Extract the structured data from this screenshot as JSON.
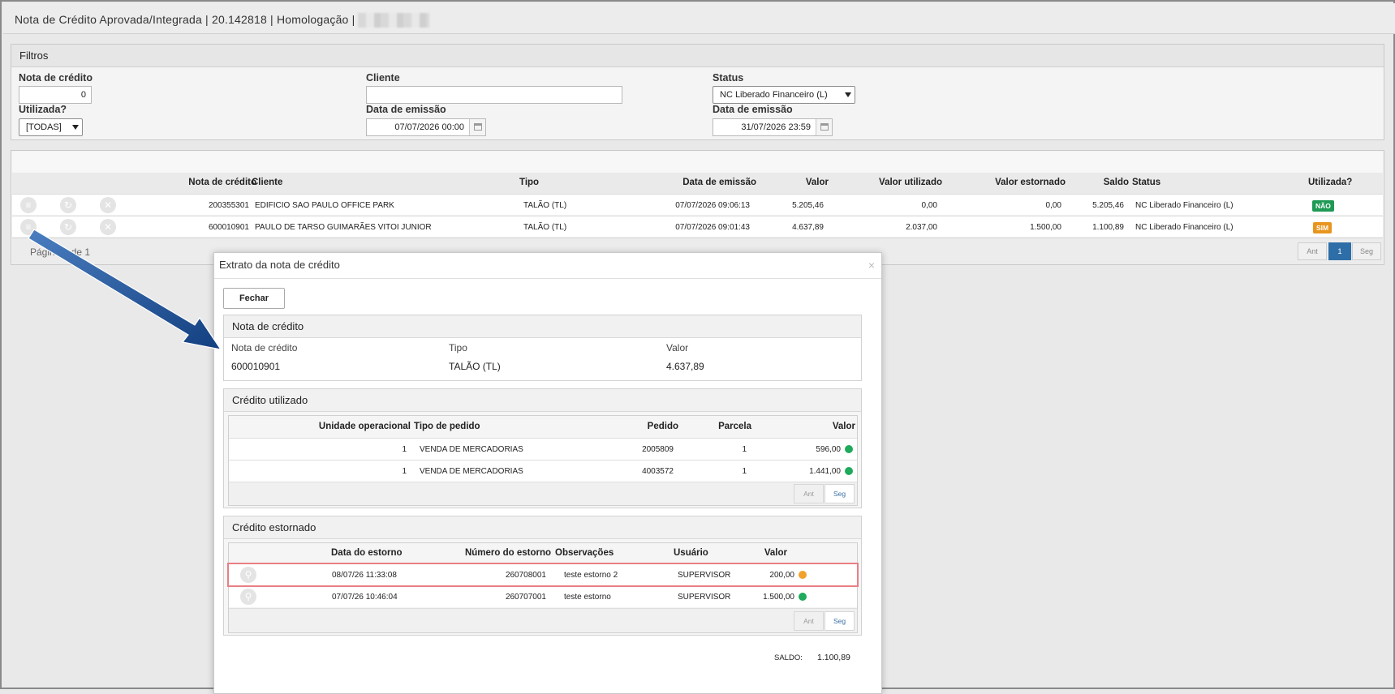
{
  "window": {
    "title": "Nota de Crédito Aprovada/Integrada | 20.142818 | Homologação |"
  },
  "filters": {
    "heading": "Filtros",
    "nota_label": "Nota de crédito",
    "nota_value": "0",
    "cliente_label": "Cliente",
    "cliente_value": "",
    "status_label": "Status",
    "status_value": "NC Liberado Financeiro (L)",
    "utilizada_label": "Utilizada?",
    "utilizada_value": "[TODAS]",
    "data_emissao_from_label": "Data de emissão",
    "data_emissao_from_value": "07/07/2026 00:00",
    "data_emissao_to_label": "Data de emissão",
    "data_emissao_to_value": "31/07/2026 23:59"
  },
  "table": {
    "headers": [
      "Nota de crédito",
      "Cliente",
      "Tipo",
      "Data de emissão",
      "Valor",
      "Valor utilizado",
      "Valor estornado",
      "Saldo",
      "Status",
      "Utilizada?"
    ],
    "rows": [
      {
        "nota": "200355301",
        "cliente": "EDIFICIO SAO PAULO OFFICE PARK",
        "tipo": "TALÃO (TL)",
        "data": "07/07/2026 09:06:13",
        "valor": "5.205,46",
        "valor_utilizado": "0,00",
        "valor_estornado": "0,00",
        "saldo": "5.205,46",
        "status": "NC Liberado Financeiro (L)",
        "utilizada": "NÃO",
        "utilizada_color": "#1f9a55"
      },
      {
        "nota": "600010901",
        "cliente": "PAULO DE TARSO GUIMARÃES VITOI JUNIOR",
        "tipo": "TALÃO (TL)",
        "data": "07/07/2026 09:01:43",
        "valor": "4.637,89",
        "valor_utilizado": "2.037,00",
        "valor_estornado": "1.500,00",
        "saldo": "1.100,89",
        "status": "NC Liberado Financeiro (L)",
        "utilizada": "SIM",
        "utilizada_color": "#e8951e"
      }
    ],
    "page_text": "Página 1 de 1",
    "pager": {
      "prev": "Ant",
      "current": "1",
      "next": "Seg"
    }
  },
  "modal": {
    "title": "Extrato da nota de crédito",
    "close_glyph": "×",
    "fechar_label": "Fechar",
    "nota_section": {
      "heading": "Nota de crédito",
      "nota_label": "Nota de crédito",
      "nota_value": "600010901",
      "tipo_label": "Tipo",
      "tipo_value": "TALÃO (TL)",
      "valor_label": "Valor",
      "valor_value": "4.637,89"
    },
    "credito_utilizado": {
      "heading": "Crédito utilizado",
      "headers": [
        "Unidade operacional",
        "Tipo de pedido",
        "Pedido",
        "Parcela",
        "Valor"
      ],
      "rows": [
        {
          "unidade": "1",
          "tipo": "VENDA DE MERCADORIAS",
          "pedido": "2005809",
          "parcela": "1",
          "valor": "596,00",
          "dot": "#1faa5c"
        },
        {
          "unidade": "1",
          "tipo": "VENDA DE MERCADORIAS",
          "pedido": "4003572",
          "parcela": "1",
          "valor": "1.441,00",
          "dot": "#1faa5c"
        }
      ],
      "pager": {
        "prev": "Ant",
        "next": "Seg"
      }
    },
    "credito_estornado": {
      "heading": "Crédito estornado",
      "headers": [
        "Data do estorno",
        "Número do estorno",
        "Observações",
        "Usuário",
        "Valor"
      ],
      "rows": [
        {
          "data": "08/07/26 11:33:08",
          "numero": "260708001",
          "obs": "teste estorno 2",
          "usuario": "SUPERVISOR",
          "valor": "200,00",
          "dot": "#f2a12a"
        },
        {
          "data": "07/07/26 10:46:04",
          "numero": "260707001",
          "obs": "teste estorno",
          "usuario": "SUPERVISOR",
          "valor": "1.500,00",
          "dot": "#1faa5c"
        }
      ],
      "pager": {
        "prev": "Ant",
        "next": "Seg"
      }
    },
    "saldo_label": "SALDO:",
    "saldo_value": "1.100,89"
  },
  "icons": {
    "menu": "≡",
    "refresh": "↻",
    "cancel": "✕",
    "search": "⚲"
  },
  "colors": {
    "pager_active": "#2e6ea8",
    "highlight_outline": "#e87f85",
    "annotation_arrow": "#1b4f8f"
  }
}
